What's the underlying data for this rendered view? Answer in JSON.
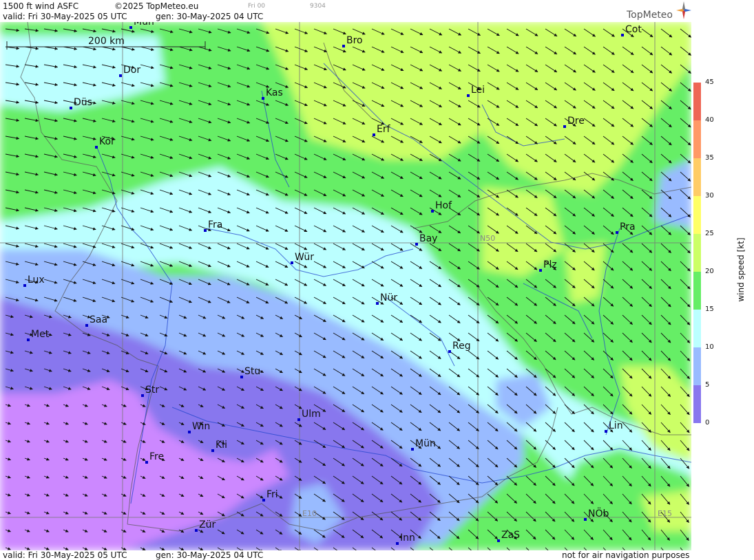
{
  "header": {
    "product": "1500 ft wind ASFC",
    "copyright": "©2025 TopMeteo.eu",
    "valid": "valid:  Fri  30-May-2025  05 UTC",
    "gen": "gen:  30-May-2025 04 UTC",
    "small_run": "Fri 00",
    "small_code": "9304",
    "logo": "TopMeteo"
  },
  "footer": {
    "valid": "valid:  Fri  30-May-2025  05 UTC",
    "gen": "gen:  30-May-2025 04 UTC",
    "disclaimer": "not for air navigation purposes"
  },
  "scale_bar": {
    "label": "200 km"
  },
  "gridlines": {
    "lat_label": "N50",
    "lon_label_1": "E10",
    "lon_label_2": "E15"
  },
  "cities": [
    {
      "name": "Mün_n",
      "label": "Mün"
    },
    {
      "name": "Bro",
      "label": "Bro"
    },
    {
      "name": "Cot",
      "label": "Cot"
    },
    {
      "name": "Dor",
      "label": "Dor"
    },
    {
      "name": "Kas",
      "label": "Kas"
    },
    {
      "name": "Lei",
      "label": "Lei"
    },
    {
      "name": "Düs",
      "label": "Düs"
    },
    {
      "name": "Dre",
      "label": "Dre"
    },
    {
      "name": "Erf",
      "label": "Erf"
    },
    {
      "name": "Köl",
      "label": "Köl"
    },
    {
      "name": "Hof",
      "label": "Hof"
    },
    {
      "name": "Fra",
      "label": "Fra"
    },
    {
      "name": "Pra",
      "label": "Pra"
    },
    {
      "name": "Bay",
      "label": "Bay"
    },
    {
      "name": "Wür",
      "label": "Wür"
    },
    {
      "name": "Plz",
      "label": "Plz"
    },
    {
      "name": "Lux",
      "label": "Lux"
    },
    {
      "name": "Nür",
      "label": "Nür"
    },
    {
      "name": "Saa",
      "label": "Saa"
    },
    {
      "name": "Met",
      "label": "Met"
    },
    {
      "name": "Reg",
      "label": "Reg"
    },
    {
      "name": "Stu",
      "label": "Stu"
    },
    {
      "name": "Str",
      "label": "Str"
    },
    {
      "name": "Ulm",
      "label": "Ulm"
    },
    {
      "name": "Lin",
      "label": "Lin"
    },
    {
      "name": "Win",
      "label": "Win"
    },
    {
      "name": "Mün_s",
      "label": "Mün"
    },
    {
      "name": "Kli",
      "label": "Kli"
    },
    {
      "name": "Fre",
      "label": "Fre"
    },
    {
      "name": "Fri",
      "label": "Fri"
    },
    {
      "name": "NÖb",
      "label": "NÖb"
    },
    {
      "name": "Zür",
      "label": "Zür"
    },
    {
      "name": "ZaS",
      "label": "ZaS"
    },
    {
      "name": "Inn",
      "label": "Inn"
    }
  ],
  "legend": {
    "title": "wind speed [kt]",
    "ticks": [
      "45",
      "40",
      "35",
      "30",
      "25",
      "20",
      "15",
      "10",
      "5",
      "0"
    ],
    "colors": [
      "#ee6655",
      "#ff9966",
      "#ffcc66",
      "#ffff66",
      "#ccff66",
      "#66ee66",
      "#bbffff",
      "#99bbff",
      "#8877ee",
      "#cc88ff"
    ]
  }
}
